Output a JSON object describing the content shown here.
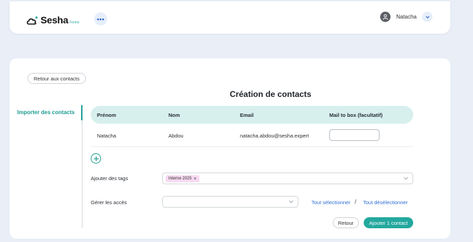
{
  "header": {
    "logo_text": "Sesha",
    "logo_sub": "Forms",
    "more_label": "•••",
    "user_name": "Natacha"
  },
  "page": {
    "back_label": "Retour aux contacts",
    "title": "Création de contacts",
    "sidebar_link": "Importer des contacts"
  },
  "table": {
    "headers": [
      "Prénom",
      "Nom",
      "Email",
      "Mail to box (facultatif)"
    ],
    "rows": [
      {
        "prenom": "Natacha",
        "nom": "Abdou",
        "email": "natacha.abdou@sesha.expert",
        "mail_box": ""
      }
    ]
  },
  "form": {
    "tags_label": "Ajouter des tags",
    "tags": [
      "Interne 2025"
    ],
    "tag_remove": "×",
    "access_label": "Gérer les accès",
    "access_value": "",
    "select_all": "Tout sélectionner",
    "separator": "/",
    "deselect_all": "Tout désélectionner"
  },
  "actions": {
    "retour": "Retour",
    "add": "Ajouter 1 contact"
  },
  "colors": {
    "accent": "#23a89e",
    "link": "#2f6fd6",
    "table_header_bg": "#d7f0ee",
    "tag_bg": "#f7d9f1",
    "page_bg": "#e9eef7"
  },
  "icons": [
    "cloud-logo-icon",
    "more-dots-icon",
    "user-avatar-icon",
    "chevron-down-icon",
    "plus-circle-icon"
  ]
}
